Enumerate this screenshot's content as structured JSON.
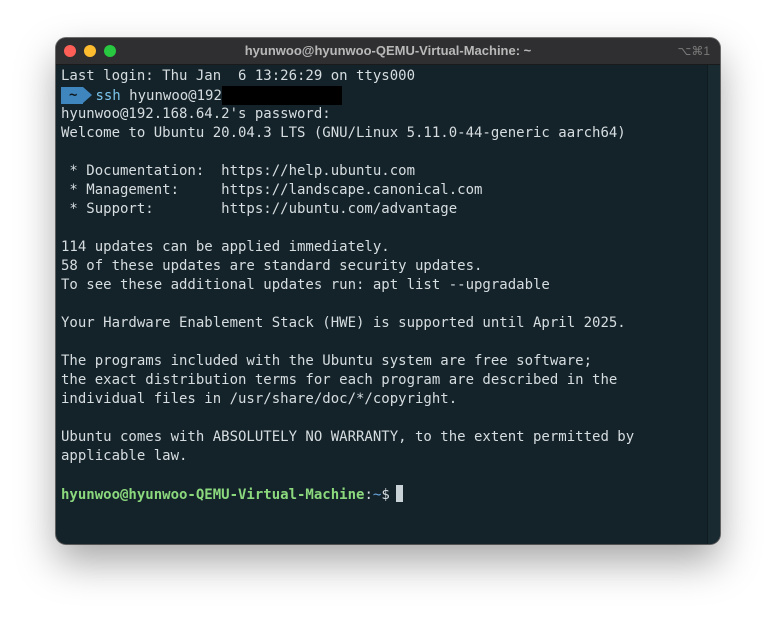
{
  "window": {
    "title": "hyunwoo@hyunwoo-QEMU-Virtual-Machine: ~",
    "shortcut": "⌥⌘1"
  },
  "terminal": {
    "last_login": "Last login: Thu Jan  6 13:26:29 on ttys000",
    "prompt_badge": "~",
    "command": "ssh",
    "command_arg": "hyunwoo@192",
    "password_prompt": "hyunwoo@192.168.64.2's password:",
    "welcome": "Welcome to Ubuntu 20.04.3 LTS (GNU/Linux 5.11.0-44-generic aarch64)",
    "links": [
      " * Documentation:  https://help.ubuntu.com",
      " * Management:     https://landscape.canonical.com",
      " * Support:        https://ubuntu.com/advantage"
    ],
    "updates": [
      "114 updates can be applied immediately.",
      "58 of these updates are standard security updates.",
      "To see these additional updates run: apt list --upgradable"
    ],
    "hwe": "Your Hardware Enablement Stack (HWE) is supported until April 2025.",
    "license": [
      "The programs included with the Ubuntu system are free software;",
      "the exact distribution terms for each program are described in the",
      "individual files in /usr/share/doc/*/copyright."
    ],
    "warranty": [
      "Ubuntu comes with ABSOLUTELY NO WARRANTY, to the extent permitted by",
      "applicable law."
    ],
    "prompt": {
      "user_host": "hyunwoo@hyunwoo-QEMU-Virtual-Machine",
      "separator": ":",
      "path": "~",
      "symbol": "$"
    }
  }
}
